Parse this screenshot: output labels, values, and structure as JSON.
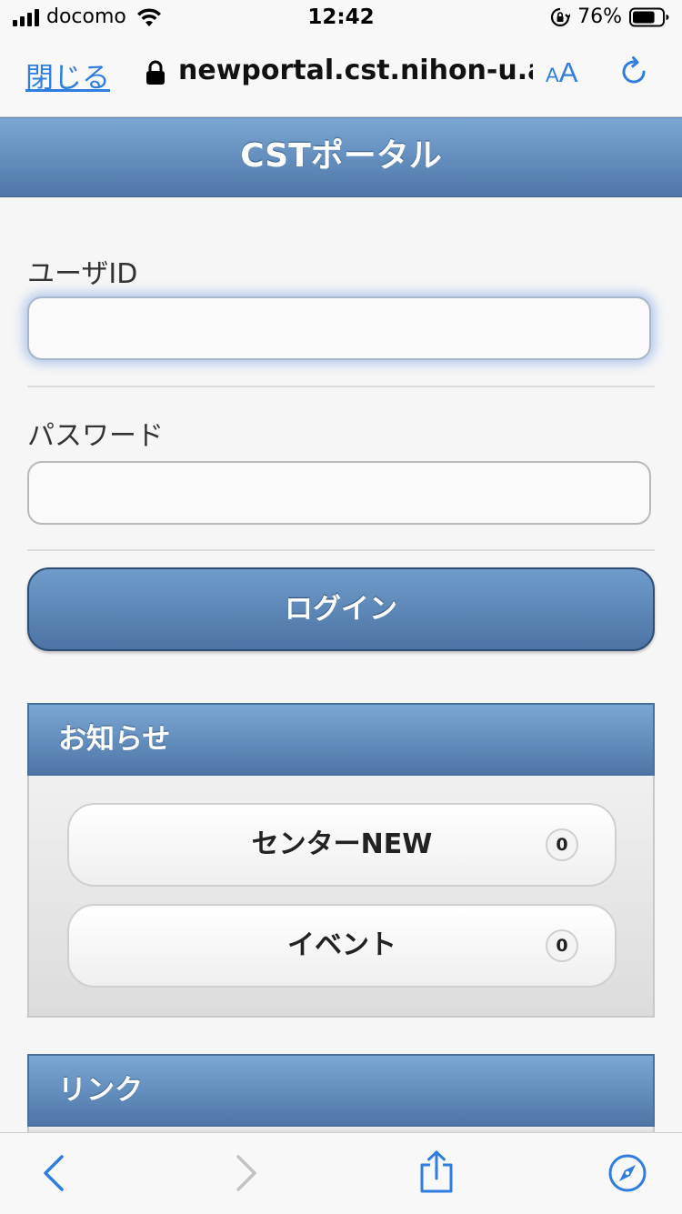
{
  "status_bar": {
    "carrier": "docomo",
    "time": "12:42",
    "battery_percent": "76%",
    "battery_level": 0.76
  },
  "browser": {
    "close_label": "閉じる",
    "url": "newportal.cst.nihon-u.a",
    "text_size_small": "A",
    "text_size_big": "A"
  },
  "page": {
    "title": "CSTポータル"
  },
  "login_form": {
    "user_id_label": "ユーザID",
    "user_id_value": "",
    "password_label": "パスワード",
    "password_value": "",
    "login_button": "ログイン"
  },
  "sections": {
    "news": {
      "title": "お知らせ",
      "items": [
        {
          "label": "センターNEW",
          "count": "0"
        },
        {
          "label": "イベント",
          "count": "0"
        }
      ]
    },
    "links": {
      "title": "リンク"
    }
  },
  "toolbar": {
    "icons": [
      "back-icon",
      "forward-icon",
      "share-icon",
      "compass-icon"
    ]
  },
  "colors": {
    "accent": "#2f7de1",
    "header_top": "#7ba7d4",
    "header_bottom": "#4e76a7"
  }
}
